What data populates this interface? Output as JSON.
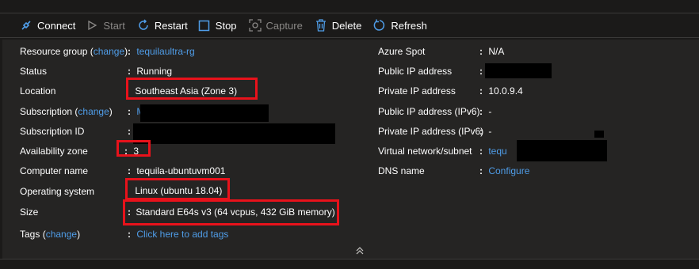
{
  "toolbar": {
    "connect": "Connect",
    "start": "Start",
    "restart": "Restart",
    "stop": "Stop",
    "capture": "Capture",
    "delete": "Delete",
    "refresh": "Refresh"
  },
  "left": {
    "resource_group": {
      "label": "Resource group",
      "change": "change",
      "value": "tequilaultra-rg"
    },
    "status": {
      "label": "Status",
      "value": "Running"
    },
    "location": {
      "label": "Location",
      "value": "Southeast Asia (Zone 3)"
    },
    "subscription": {
      "label": "Subscription",
      "change": "change",
      "value": "M"
    },
    "subscription_id": {
      "label": "Subscription ID",
      "value": ""
    },
    "availability_zone": {
      "label": "Availability zone",
      "value": "3"
    },
    "computer_name": {
      "label": "Computer name",
      "value": "tequila-ubuntuvm001"
    },
    "operating_system": {
      "label": "Operating system",
      "value": "Linux (ubuntu 18.04)"
    },
    "size": {
      "label": "Size",
      "value": "Standard E64s v3 (64 vcpus, 432 GiB memory)"
    },
    "tags": {
      "label": "Tags",
      "change": "change",
      "value": "Click here to add tags"
    }
  },
  "right": {
    "azure_spot": {
      "label": "Azure Spot",
      "value": "N/A"
    },
    "public_ip": {
      "label": "Public IP address",
      "value": ""
    },
    "private_ip": {
      "label": "Private IP address",
      "value": "10.0.9.4"
    },
    "public_ipv6": {
      "label": "Public IP address (IPv6)",
      "value": "-"
    },
    "private_ipv6": {
      "label": "Private IP address (IPv6)",
      "value": "-"
    },
    "vnet": {
      "label": "Virtual network/subnet",
      "value": "tequ"
    },
    "dns": {
      "label": "DNS name",
      "value": "Configure"
    }
  },
  "colors": {
    "link": "#4f9de8",
    "highlight": "#e8121b",
    "background": "#252423"
  },
  "icons": [
    "connect-plug-icon",
    "start-play-icon",
    "restart-icon",
    "stop-square-icon",
    "capture-icon",
    "delete-trash-icon",
    "refresh-icon",
    "collapse-chevron-icon"
  ]
}
